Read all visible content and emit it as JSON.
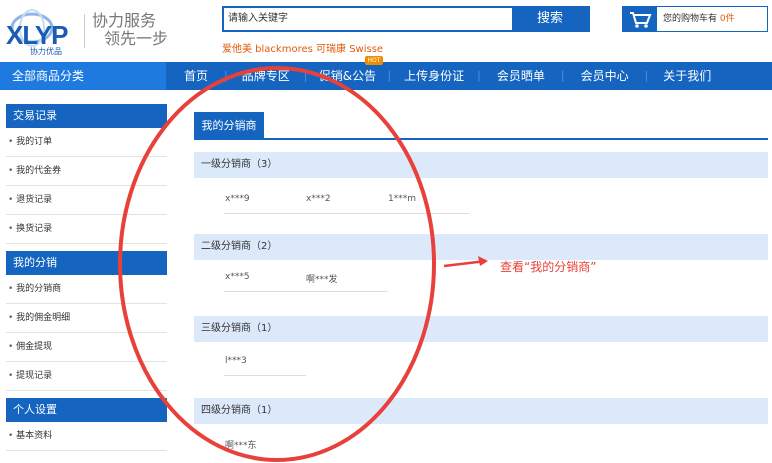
{
  "header": {
    "logo_text": "XLYP",
    "logo_subtext": "协力优品",
    "slogan_line1": "协力服务",
    "slogan_line2": "领先一步",
    "search_placeholder": "请输入关键字",
    "search_button": "搜索",
    "hot_words": "爱他美 blackmores 可瑞康 Swisse",
    "cart_prefix": "您的购物车有",
    "cart_count": "0件"
  },
  "nav": {
    "all_categories": "全部商品分类",
    "items": [
      "首页",
      "品牌专区",
      "促销&公告",
      "上传身份证",
      "会员晒单",
      "会员中心",
      "关于我们"
    ],
    "hot_badge": "HOT"
  },
  "sidebar": {
    "groups": [
      {
        "title": "交易记录",
        "items": [
          "我的订单",
          "我的代金券",
          "退货记录",
          "换货记录"
        ]
      },
      {
        "title": "我的分销",
        "items": [
          "我的分销商",
          "我的佣金明细",
          "佣金提现",
          "提现记录"
        ]
      },
      {
        "title": "个人设置",
        "items": [
          "基本资料"
        ]
      }
    ]
  },
  "main": {
    "tab": "我的分销商",
    "levels": [
      {
        "title": "一级分销商（3）",
        "members": [
          "x***9",
          "x***2",
          "1***m"
        ]
      },
      {
        "title": "二级分销商（2）",
        "members": [
          "x***5",
          "啊***发"
        ]
      },
      {
        "title": "三级分销商（1）",
        "members": [
          "l***3"
        ]
      },
      {
        "title": "四级分销商（1）",
        "members": [
          "啊***东"
        ]
      }
    ]
  },
  "annotation": {
    "text": "查看“我的分销商”",
    "color": "#e8403a"
  },
  "colors": {
    "primary": "#1565c0",
    "accent": "#e25a0a",
    "level_header_bg": "#dbe9fb"
  }
}
